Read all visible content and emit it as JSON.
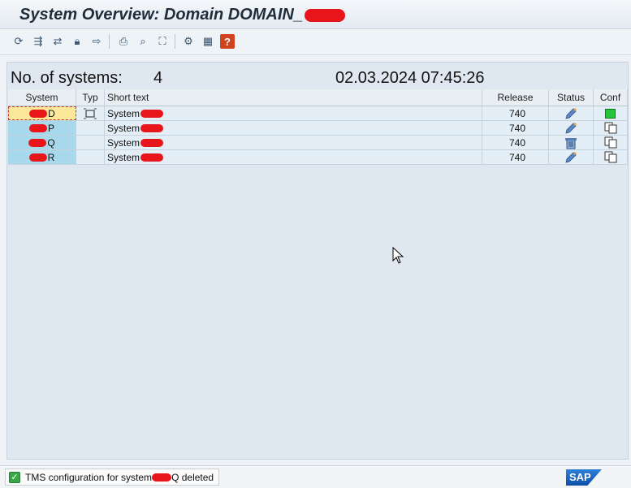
{
  "window": {
    "title": "System Overview: Domain DOMAIN_"
  },
  "toolbar": {
    "icons": [
      "refresh-icon",
      "distribute-config-icon",
      "check-connection-icon",
      "lock-icon",
      "transport-icon",
      "print-icon",
      "find-icon",
      "select-all-icon",
      "settings-icon",
      "layout-icon",
      "help-icon"
    ]
  },
  "summary": {
    "count_label": "No. of systems:",
    "count_value": "4",
    "datetime": "02.03.2024 07:45:26"
  },
  "table": {
    "headers": {
      "system": "System",
      "typ": "Typ",
      "short_text": "Short text",
      "release": "Release",
      "status": "Status",
      "conf": "Conf"
    },
    "rows": [
      {
        "system": "D",
        "short_text": "System",
        "release": "740",
        "status_icon": "pencil-icon",
        "conf_icon": "green-square-icon"
      },
      {
        "system": "P",
        "short_text": "System",
        "release": "740",
        "status_icon": "pencil-icon",
        "conf_icon": "copy-icon"
      },
      {
        "system": "Q",
        "short_text": "System",
        "release": "740",
        "status_icon": "trash-icon",
        "conf_icon": "copy-icon"
      },
      {
        "system": "R",
        "short_text": "System",
        "release": "740",
        "status_icon": "pencil-icon",
        "conf_icon": "copy-icon"
      }
    ]
  },
  "status_bar": {
    "message_before": "TMS configuration for system",
    "message_after": "Q deleted",
    "logo": "SAP"
  },
  "colors": {
    "redaction": "#e8151b",
    "system_cell": "#a8d8ec",
    "selected_cell": "#fbe89a",
    "status_ok": "#3aa64a",
    "sap_blue": "#0b4fa6"
  }
}
